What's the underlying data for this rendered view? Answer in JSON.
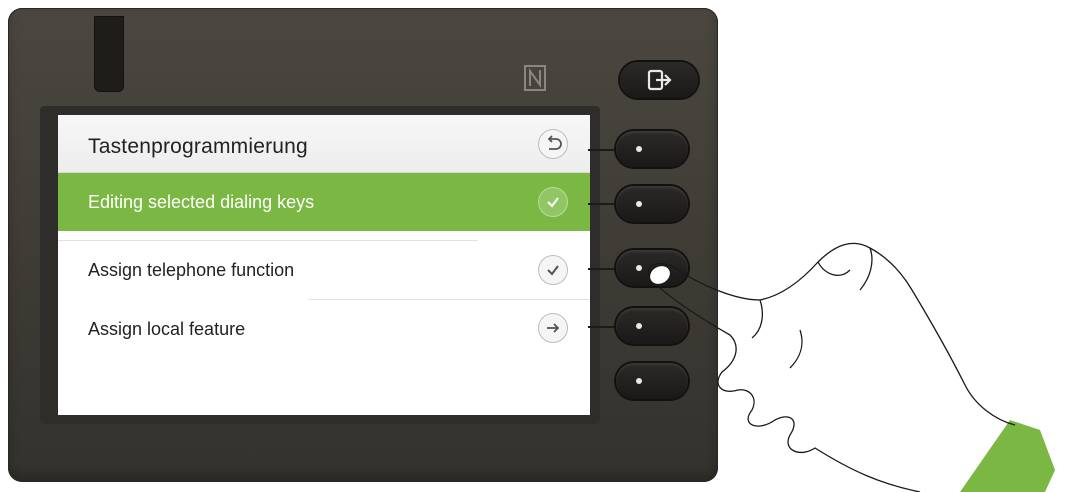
{
  "screen": {
    "title": "Tastenprogrammierung",
    "back_icon": "back-arrow-icon",
    "items": [
      {
        "label": "Editing selected dialing keys",
        "icon": "checkmark-icon",
        "selected": true
      },
      {
        "label": "Assign telephone function",
        "icon": "checkmark-icon",
        "selected": false
      },
      {
        "label": "Assign local feature",
        "icon": "arrow-right-icon",
        "selected": false
      }
    ]
  },
  "device": {
    "nfc_icon": "nfc-icon",
    "logout_icon": "logout-icon",
    "accent_color": "#7ab843"
  }
}
